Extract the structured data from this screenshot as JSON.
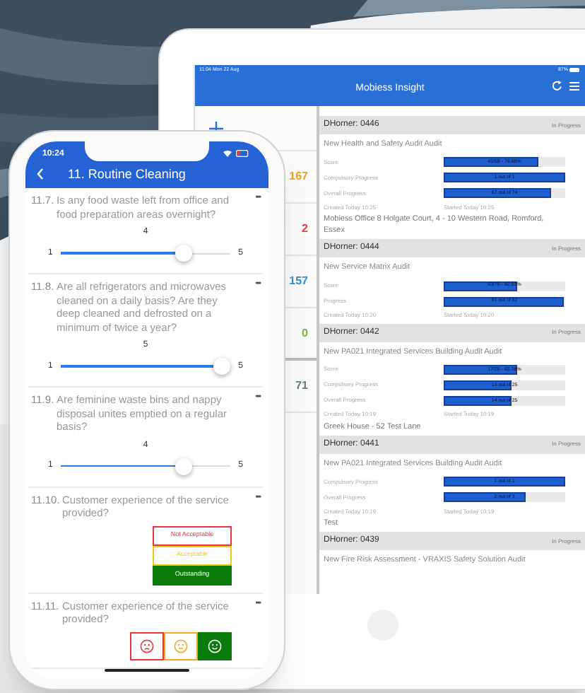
{
  "tablet": {
    "status_time": "11:04  Mon 22 Aug",
    "battery": "87%",
    "title": "Mobiess Insight",
    "counts": [
      {
        "value": "167",
        "color": "#f0a020"
      },
      {
        "value": "2",
        "color": "#e53935"
      },
      {
        "value": "157",
        "color": "#2f8fd8"
      },
      {
        "value": "0",
        "color": "#7cb342"
      },
      {
        "value": "71",
        "color": "#607d8b"
      }
    ],
    "audits": [
      {
        "ref": "DHorner: 0446",
        "status": "In Progress",
        "title": "New Health and Safety Audit Audit",
        "metrics": [
          {
            "label": "Score",
            "reading": "45/59 - 76.88%",
            "level": 0.78
          },
          {
            "label": "Compulsory Progress",
            "reading": "1 out of 1",
            "level": 1
          },
          {
            "label": "Overall Progress",
            "reading": "67 out of 74",
            "level": 0.88
          }
        ],
        "created": "Created Today 10:25",
        "started": "Started Today 10:25",
        "address": "Mobiess Office 8 Holgate Court, 4 - 10 Western Road, Romford, Essex"
      },
      {
        "ref": "DHorner: 0444",
        "status": "In Progress",
        "title": "New Service Matrix Audit",
        "metrics": [
          {
            "label": "Score",
            "reading": "63/76 - 82.83%",
            "level": 0.6
          },
          {
            "label": "Progress",
            "reading": "81 out of 82",
            "level": 0.99
          }
        ],
        "created": "Created Today 10:20",
        "started": "Started Today 10:20"
      },
      {
        "ref": "DHorner: 0442",
        "status": "In Progress",
        "title": "New PA021 Integrated Services Building Audit Audit",
        "metrics": [
          {
            "label": "Score",
            "reading": "17/26 - 65.38%",
            "level": 0.6
          },
          {
            "label": "Compulsory Progress",
            "reading": "14 out of 25",
            "level": 0.56
          },
          {
            "label": "Overall Progress",
            "reading": "14 out of 25",
            "level": 0.56
          }
        ],
        "created": "Created Today 10:19",
        "started": "Started Today 10:19",
        "address": "Greek House - 52 Test Lane"
      },
      {
        "ref": "DHorner: 0441",
        "status": "In Progress",
        "title": "New PA021 Integrated Services Building Audit Audit",
        "metrics": [
          {
            "label": "Compulsory Progress",
            "reading": "1 out of 1",
            "level": 1
          },
          {
            "label": "Overall Progress",
            "reading": "2 out of 3",
            "level": 0.67
          }
        ],
        "created": "Created Today 10:19",
        "started": "Started Today 10:19",
        "address": "Test"
      },
      {
        "ref": "DHorner: 0439",
        "status": "In Progress",
        "title": "New Fire Risk Assessment - VRAXIS Safety Solution Audit"
      }
    ]
  },
  "phone": {
    "time": "10:24",
    "title": "11. Routine Cleaning",
    "questions": [
      {
        "kind": "slider",
        "number": "11.7.",
        "text": "Is any food waste left from office and food preparation areas overnight?",
        "menu": "•••",
        "value": "4",
        "min": "1",
        "max": "5",
        "level": 0.75
      },
      {
        "kind": "slider",
        "number": "11.8.",
        "text": "Are all refrigerators and microwaves cleaned on a daily basis? Are they deep cleaned and defrosted on a minimum of twice a year?",
        "menu": "•••",
        "value": "5",
        "min": "1",
        "max": "5",
        "level": 1
      },
      {
        "kind": "slider",
        "number": "11.9.",
        "text": "Are feminine waste bins and nappy disposal unites emptied on a regular basis?",
        "menu": "•••",
        "value": "4",
        "min": "1",
        "max": "5",
        "level": 0.75
      },
      {
        "kind": "choice",
        "number": "11.10.",
        "text": "Customer experience of the service provided?",
        "menu": "•••",
        "options": [
          {
            "label": "Not Acceptable",
            "color": "#f0323c",
            "selected": false
          },
          {
            "label": "Acceptable",
            "color": "#f5c518",
            "selected": false
          },
          {
            "label": "Outstanding",
            "color": "#0a7a0a",
            "selected": true
          }
        ]
      },
      {
        "kind": "faces",
        "number": "11.11.",
        "text": "Customer experience of the service provided?",
        "menu": "•••",
        "options": [
          {
            "kind": "sad",
            "color": "#f0323c",
            "selected": false
          },
          {
            "kind": "neutral",
            "color": "#f5a623",
            "selected": false
          },
          {
            "kind": "happy",
            "color": "#0a7a0a",
            "selected": true
          }
        ]
      }
    ]
  }
}
